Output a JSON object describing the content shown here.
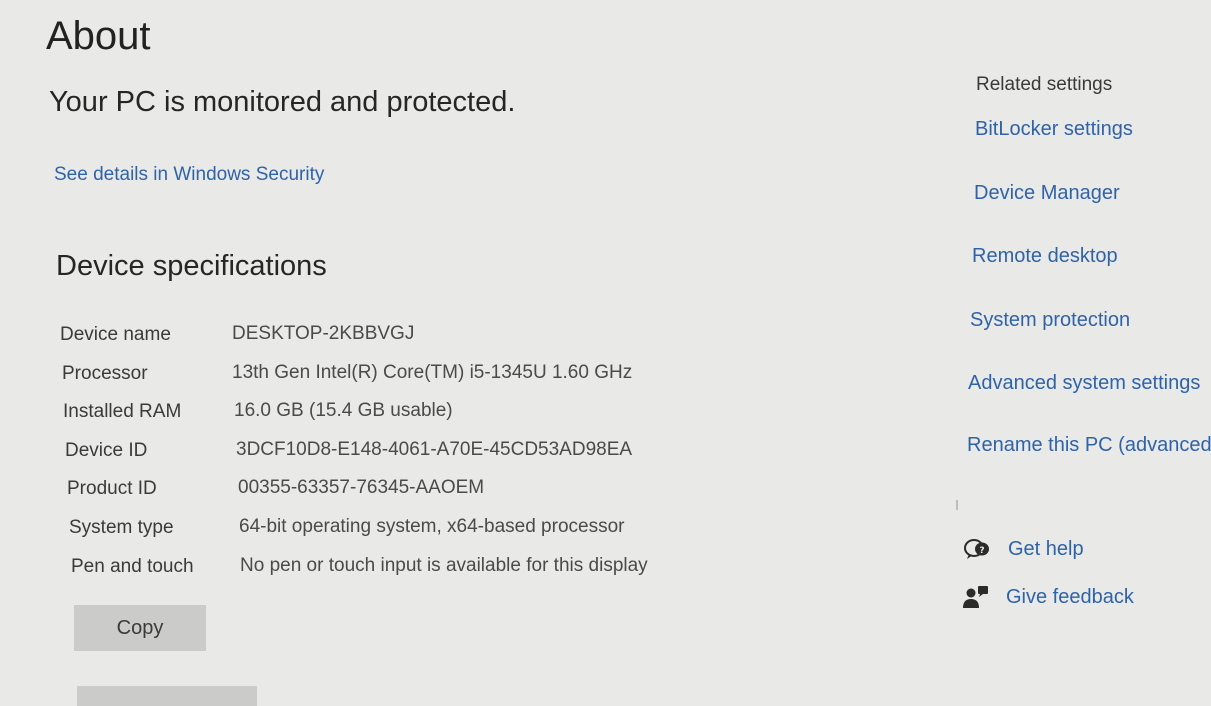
{
  "page": {
    "title": "About",
    "status_heading": "Your PC is monitored and protected.",
    "security_link": "See details in Windows Security"
  },
  "specs": {
    "heading": "Device specifications",
    "rows": [
      {
        "label": "Device name",
        "value": "DESKTOP-2KBBVGJ"
      },
      {
        "label": "Processor",
        "value": "13th Gen Intel(R) Core(TM) i5-1345U   1.60 GHz"
      },
      {
        "label": "Installed RAM",
        "value": "16.0 GB (15.4 GB usable)"
      },
      {
        "label": "Device ID",
        "value": "3DCF10D8-E148-4061-A70E-45CD53AD98EA"
      },
      {
        "label": "Product ID",
        "value": "00355-63357-76345-AAOEM"
      },
      {
        "label": "System type",
        "value": "64-bit operating system, x64-based processor"
      },
      {
        "label": "Pen and touch",
        "value": "No pen or touch input is available for this display"
      }
    ],
    "copy_label": "Copy"
  },
  "related": {
    "heading": "Related settings",
    "links": [
      "BitLocker settings",
      "Device Manager",
      "Remote desktop",
      "System protection",
      "Advanced system settings",
      "Rename this PC (advanced)"
    ]
  },
  "help": {
    "get_help": "Get help",
    "give_feedback": "Give feedback"
  },
  "colors": {
    "background": "#e9e9e7",
    "link": "#2f63a8",
    "button": "#cbcbc9",
    "text": "#2b2b2b"
  },
  "icons": {
    "get_help": "help-chat-icon",
    "give_feedback": "feedback-person-icon"
  }
}
